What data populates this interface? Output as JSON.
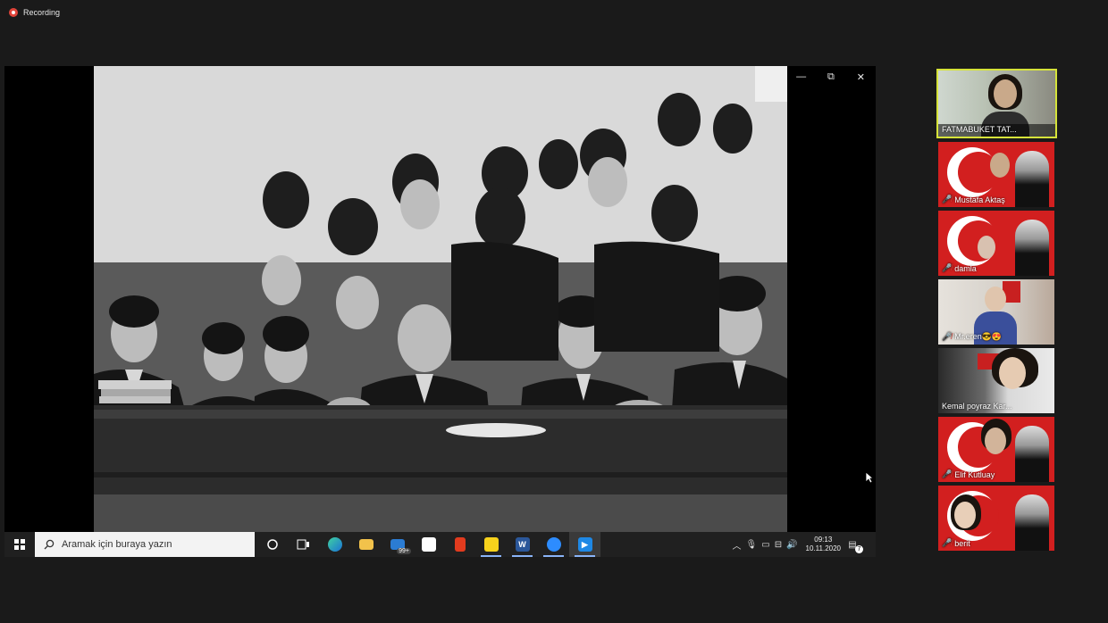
{
  "recording": {
    "label": "Recording"
  },
  "window_controls": {
    "minimize": "—",
    "restore": "⧉",
    "close": "✕"
  },
  "taskbar": {
    "search_placeholder": "Aramak için buraya yazın",
    "mail_badge": "99+",
    "time": "09:13",
    "date": "10.11.2020",
    "notifications": "7",
    "icons": [
      "cortana-icon",
      "task-view-icon",
      "edge-icon",
      "file-explorer-icon",
      "mail-icon",
      "store-icon",
      "office-icon",
      "sticky-notes-icon",
      "word-icon",
      "zoom-icon",
      "media-player-icon"
    ]
  },
  "participants": [
    {
      "name": "FATMABUKET TAT...",
      "muted": false,
      "speaking": true
    },
    {
      "name": "Mustafa Aktaş",
      "muted": true
    },
    {
      "name": "damla",
      "muted": true
    },
    {
      "name": "Mr.eren😎😍",
      "muted": true
    },
    {
      "name": "Kemal poyraz Kar...",
      "muted": false
    },
    {
      "name": "Elif Kutluay",
      "muted": true
    },
    {
      "name": "berit",
      "muted": true
    }
  ]
}
